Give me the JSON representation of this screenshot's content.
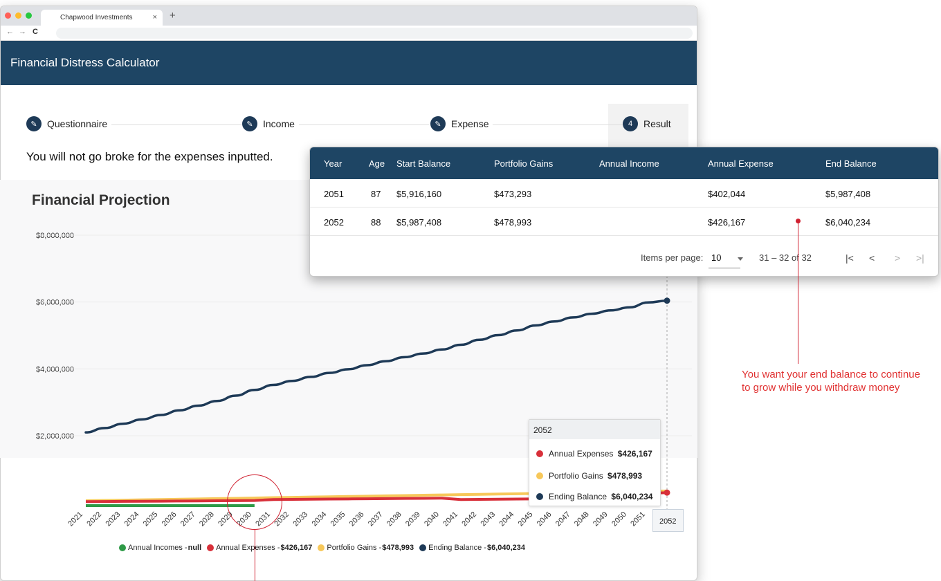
{
  "browser": {
    "tab_title": "Chapwood Investments",
    "tab_close": "×",
    "new_tab": "+",
    "back": "←",
    "forward": "→",
    "reload": "C",
    "dot_colors": [
      "#ff5f57",
      "#febc2e",
      "#28c840"
    ]
  },
  "app": {
    "title": "Financial Distress Calculator",
    "header_color": "#1e4564"
  },
  "stepper": {
    "steps": [
      {
        "label": "Questionnaire",
        "icon": "pencil-icon"
      },
      {
        "label": "Income",
        "icon": "pencil-icon"
      },
      {
        "label": "Expense",
        "icon": "pencil-icon"
      },
      {
        "label": "Result",
        "number": "4"
      }
    ]
  },
  "result_message": "You will not go broke for the expenses inputted.",
  "chart_data": {
    "type": "line",
    "title": "Financial Projection",
    "x": [
      "2021",
      "2022",
      "2023",
      "2024",
      "2025",
      "2026",
      "2027",
      "2028",
      "2029",
      "2030",
      "2031",
      "2032",
      "2033",
      "2034",
      "2035",
      "2036",
      "2037",
      "2038",
      "2039",
      "2040",
      "2041",
      "2042",
      "2043",
      "2044",
      "2045",
      "2046",
      "2047",
      "2048",
      "2049",
      "2050",
      "2051",
      "2052"
    ],
    "y_ticks": [
      "$8,000,000",
      "$6,000,000",
      "$4,000,000",
      "$2,000,000"
    ],
    "ylim": [
      2000000,
      8000000
    ],
    "series": [
      {
        "name": "Ending Balance",
        "color": "#1e3a57",
        "values": [
          2100000,
          2230000,
          2360000,
          2490000,
          2620000,
          2760000,
          2900000,
          3040000,
          3200000,
          3370000,
          3520000,
          3640000,
          3760000,
          3880000,
          3990000,
          4110000,
          4230000,
          4350000,
          4460000,
          4580000,
          4720000,
          4870000,
          5010000,
          5150000,
          5300000,
          5420000,
          5540000,
          5650000,
          5750000,
          5840000,
          5987408,
          6040234
        ]
      },
      {
        "name": "Annual Incomes",
        "color": "#2e9a47",
        "values": [
          1,
          1,
          1,
          1,
          1,
          1,
          1,
          1,
          1,
          1,
          null,
          null,
          null,
          null,
          null,
          null,
          null,
          null,
          null,
          null,
          null,
          null,
          null,
          null,
          null,
          null,
          null,
          null,
          null,
          null,
          null,
          null
        ]
      },
      {
        "name": "Annual Expenses",
        "color": "#d8303a",
        "values": [
          130000,
          134000,
          138000,
          142000,
          146000,
          150000,
          154000,
          158000,
          163000,
          168000,
          200000,
          205000,
          210000,
          215000,
          220000,
          225000,
          230000,
          235000,
          240000,
          245000,
          200000,
          205000,
          210000,
          215000,
          220000,
          225000,
          230000,
          240000,
          270000,
          300000,
          402044,
          426167
        ]
      },
      {
        "name": "Portfolio Gains",
        "color": "#f7c85a",
        "values": [
          160000,
          170000,
          180000,
          190000,
          200000,
          210000,
          220000,
          230000,
          240000,
          250000,
          260000,
          270000,
          280000,
          290000,
          300000,
          310000,
          320000,
          330000,
          340000,
          350000,
          360000,
          370000,
          380000,
          390000,
          400000,
          410000,
          420000,
          430000,
          440000,
          450000,
          473293,
          478993
        ]
      }
    ]
  },
  "tooltip": {
    "year": "2052",
    "rows": [
      {
        "label": "Annual Expenses",
        "value": "$426,167",
        "color": "#d8303a"
      },
      {
        "label": "Portfolio Gains",
        "value": "$478,993",
        "color": "#f7c85a"
      },
      {
        "label": "Ending Balance",
        "value": "$6,040,234",
        "color": "#1e3a57"
      }
    ]
  },
  "year_tip": "2052",
  "legend": [
    {
      "label": "Annual Incomes - ",
      "value": "null",
      "color": "#2e9a47"
    },
    {
      "label": "Annual Expenses - ",
      "value": "$426,167",
      "color": "#d8303a"
    },
    {
      "label": "Portfolio Gains - ",
      "value": "$478,993",
      "color": "#f7c85a"
    },
    {
      "label": "Ending Balance - ",
      "value": "$6,040,234",
      "color": "#1e3a57"
    }
  ],
  "table": {
    "headers": [
      "Year",
      "Age",
      "Start Balance",
      "Portfolio Gains",
      "Annual Income",
      "Annual Expense",
      "End Balance"
    ],
    "rows": [
      [
        "2051",
        "87",
        "$5,916,160",
        "$473,293",
        "",
        "$402,044",
        "$5,987,408"
      ],
      [
        "2052",
        "88",
        "$5,987,408",
        "$478,993",
        "",
        "$426,167",
        "$6,040,234"
      ]
    ],
    "items_per_page_label": "Items per page:",
    "items_per_page": "10",
    "range": "31 – 32 of 32",
    "nav": [
      "|<",
      "<",
      ">",
      ">|"
    ]
  },
  "annotation": "You want your end balance to continue to grow while you withdraw money",
  "annotation_color": "#e03030"
}
